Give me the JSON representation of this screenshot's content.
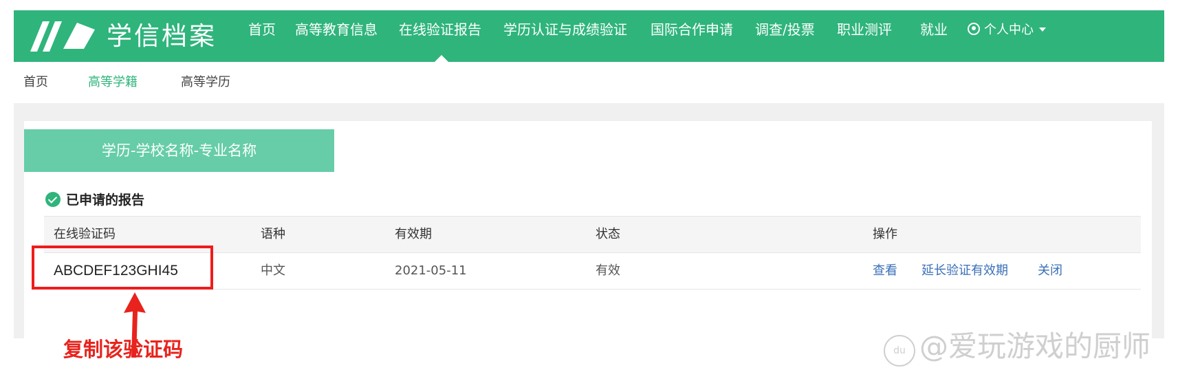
{
  "header": {
    "logo_text": "学信档案",
    "nav": [
      {
        "label": "首页"
      },
      {
        "label": "高等教育信息"
      },
      {
        "label": "在线验证报告"
      },
      {
        "label": "学历认证与成绩验证"
      },
      {
        "label": "国际合作申请"
      },
      {
        "label": "调查/投票"
      },
      {
        "label": "职业测评"
      },
      {
        "label": "就业"
      }
    ],
    "active_nav": "在线验证报告",
    "user_menu": "个人中心"
  },
  "subnav": {
    "items": [
      {
        "label": "首页"
      },
      {
        "label": "高等学籍"
      },
      {
        "label": "高等学历"
      }
    ],
    "active": "高等学籍"
  },
  "card": {
    "tab_label": "学历-学校名称-专业名称",
    "section_title": "已申请的报告",
    "table": {
      "headers": [
        "在线验证码",
        "语种",
        "有效期",
        "状态",
        "操作"
      ],
      "rows": [
        {
          "code": "ABCDEF123GHI45",
          "language": "中文",
          "expiry": "2021-05-11",
          "status": "有效",
          "actions": [
            "查看",
            "延长验证有效期",
            "关闭"
          ]
        }
      ]
    }
  },
  "annotation": {
    "text": "复制该验证码",
    "color": "#e8231d"
  },
  "watermark": {
    "badge": "du",
    "text": "@爱玩游戏的厨师"
  },
  "colors": {
    "brand_green": "#2fb47c",
    "tab_green": "#66cda8",
    "link_blue": "#3a6fb8"
  }
}
